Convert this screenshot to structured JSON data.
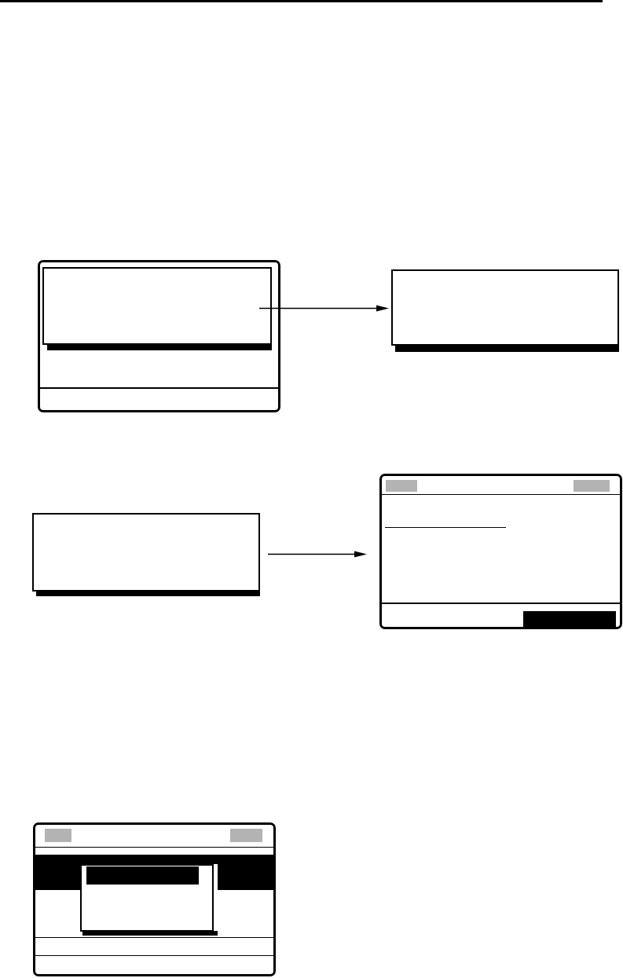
{
  "rows": [
    {
      "screens": [
        {
          "kind": "display_dialog"
        },
        {
          "kind": "dialog"
        }
      ]
    },
    {
      "screens": [
        {
          "kind": "dialog"
        },
        {
          "kind": "display_form",
          "softkeys": [
            {
              "selected": true
            }
          ]
        }
      ]
    },
    {
      "screens": [
        {
          "kind": "display_menu",
          "list": [
            {
              "selected": true
            }
          ],
          "menu": [
            {
              "selected": true
            }
          ]
        }
      ]
    }
  ]
}
